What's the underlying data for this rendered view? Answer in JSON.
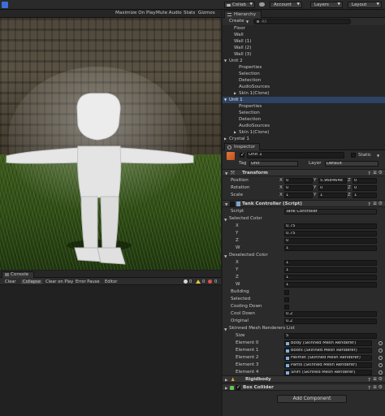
{
  "toolbar": {
    "collab": "Collab",
    "account": "Account",
    "layers": "Layers",
    "layout": "Layout"
  },
  "game": {
    "maximize": "Maximize On Play",
    "mute": "Mute Audio",
    "stats": "Stats",
    "gizmos": "Gizmos"
  },
  "console": {
    "tab": "Console",
    "clear": "Clear",
    "collapse": "Collapse",
    "clear_on_play": "Clear on Play",
    "error_pause": "Error Pause",
    "editor": "Editor",
    "count_logs": "0",
    "count_warnings": "0",
    "count_errors": "0"
  },
  "hierarchy": {
    "tab": "Hierarchy",
    "create": "Create",
    "search_placeholder": "All",
    "items": [
      {
        "label": "Floor",
        "indent": 1
      },
      {
        "label": "Wall",
        "indent": 1
      },
      {
        "label": "Wall (1)",
        "indent": 1
      },
      {
        "label": "Wall (2)",
        "indent": 1
      },
      {
        "label": "Wall (3)",
        "indent": 1
      },
      {
        "label": "Unit 2",
        "indent": 0,
        "arrow": "▼"
      },
      {
        "label": "Properties",
        "indent": 2
      },
      {
        "label": "Selection",
        "indent": 2
      },
      {
        "label": "Detection",
        "indent": 2
      },
      {
        "label": "AudioSources",
        "indent": 2
      },
      {
        "label": "Skin 1(Clone)",
        "indent": 2,
        "arrow": "▶"
      },
      {
        "label": "Unit 1",
        "indent": 0,
        "arrow": "▼",
        "selected": true
      },
      {
        "label": "Properties",
        "indent": 2
      },
      {
        "label": "Selection",
        "indent": 2
      },
      {
        "label": "Detection",
        "indent": 2
      },
      {
        "label": "AudioSources",
        "indent": 2
      },
      {
        "label": "Skin 1(Clone)",
        "indent": 2,
        "arrow": "▶"
      },
      {
        "label": "Crystal 1",
        "indent": 0,
        "arrow": "▶"
      }
    ]
  },
  "inspector": {
    "tab": "Inspector",
    "object_name": "Unit 1",
    "static_label": "Static",
    "tag_label": "Tag",
    "tag_value": "Unit",
    "layer_label": "Layer",
    "layer_value": "Default",
    "transform": {
      "title": "Transform",
      "position_label": "Position",
      "rotation_label": "Rotation",
      "scale_label": "Scale",
      "x_label": "X",
      "y_label": "Y",
      "z_label": "Z",
      "position": [
        "0",
        "5.968464e",
        "0"
      ],
      "rotation": [
        "0",
        "0",
        "0"
      ],
      "scale": [
        "1",
        "1",
        "1"
      ]
    },
    "tank_controller": {
      "title": "Tank Controller (Script)",
      "script_label": "Script",
      "script_value": "Tank Controller",
      "selected_color_label": "Selected Color",
      "selected_color": [
        {
          "label": "X",
          "value": "0.75"
        },
        {
          "label": "Y",
          "value": "0.75"
        },
        {
          "label": "Z",
          "value": "0"
        },
        {
          "label": "W",
          "value": "1"
        }
      ],
      "deselected_color_label": "Deselected Color",
      "deselected_color": [
        {
          "label": "X",
          "value": "1"
        },
        {
          "label": "Y",
          "value": "1"
        },
        {
          "label": "Z",
          "value": "1"
        },
        {
          "label": "W",
          "value": "1"
        }
      ],
      "building_label": "Building",
      "selected_label": "Selected",
      "cooling_down_label": "Cooling Down",
      "cool_down_label": "Cool Down",
      "cool_down_value": "0.2",
      "original_label": "Original",
      "original_value": "0.2",
      "skinned_list_label": "Skinned Mesh Renderers List",
      "size_label": "Size",
      "size_value": "5",
      "elements": [
        {
          "label": "Element 0",
          "value": "Body (Skinned Mesh Renderer)"
        },
        {
          "label": "Element 1",
          "value": "Boots (Skinned Mesh Renderer)"
        },
        {
          "label": "Element 2",
          "value": "Helmet (Skinned Mesh Renderer)"
        },
        {
          "label": "Element 3",
          "value": "Pants (Skinned Mesh Renderer)"
        },
        {
          "label": "Element 4",
          "value": "Shirt (Skinned Mesh Renderer)"
        }
      ]
    },
    "rigidbody_title": "Rigidbody",
    "box_collider_title": "Box Collider",
    "add_component": "Add Component"
  },
  "colors": {
    "selection": "#2e4262",
    "panel": "#2b2b2b",
    "field": "#1c1c1c"
  }
}
